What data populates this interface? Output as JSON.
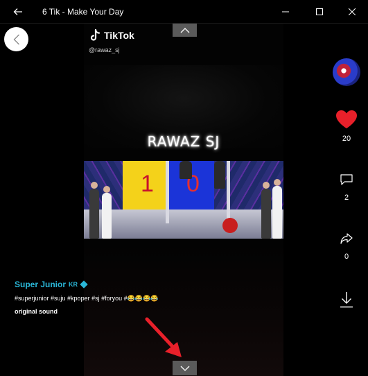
{
  "window": {
    "title": "6 Tik - Make Your Day"
  },
  "video": {
    "brand": "TikTok",
    "handle": "@rawaz_sj",
    "overlay_caption": "RAWAZ SJ",
    "scoreboard_left": "1",
    "scoreboard_right": "0"
  },
  "post": {
    "author": "Super Junior",
    "author_suffix": "KR",
    "description": "#superjunior #suju #kpoper #sj #foryou #😂😂😂😂",
    "sound": "original sound"
  },
  "rail": {
    "likes": "20",
    "comments": "2",
    "shares": "0"
  },
  "colors": {
    "like_heart": "#e8202a",
    "author_name": "#2ab7d8",
    "annotation_arrow": "#e8202a"
  }
}
